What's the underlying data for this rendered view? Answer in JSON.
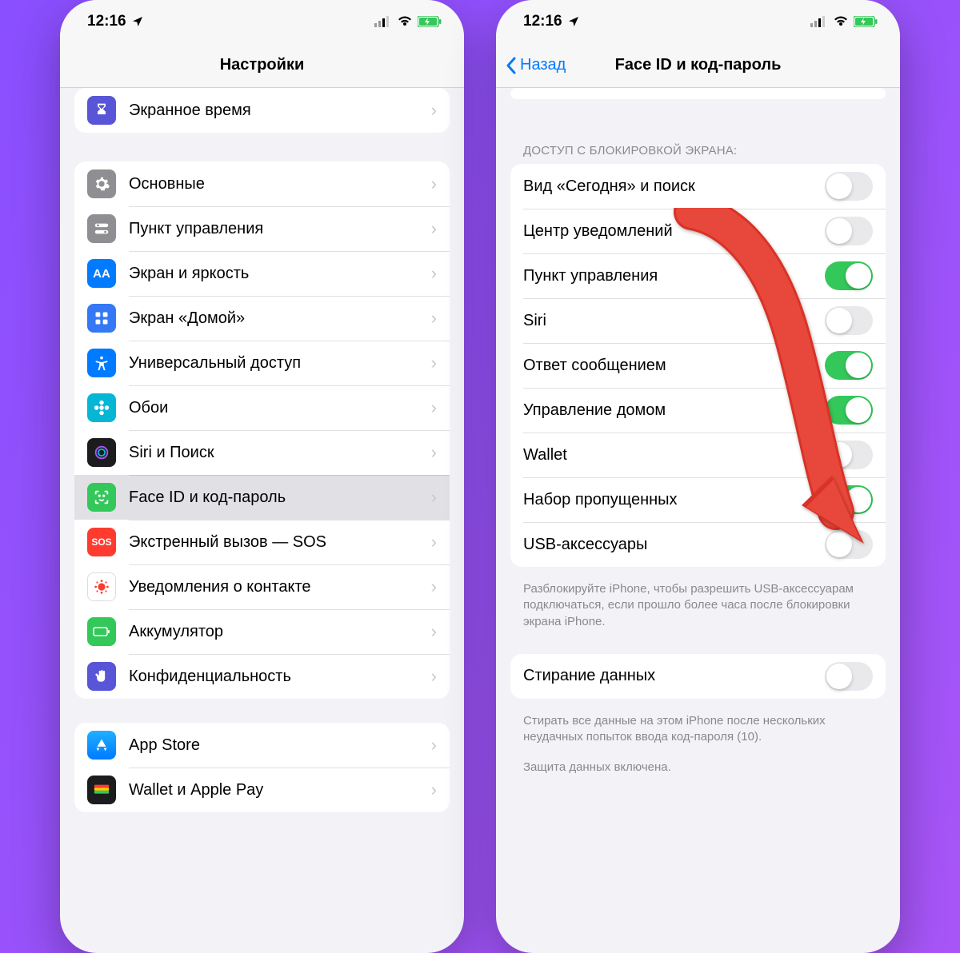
{
  "status": {
    "time": "12:16"
  },
  "left": {
    "nav_title": "Настройки",
    "g1": [
      {
        "id": "screen-time",
        "label": "Экранное время"
      }
    ],
    "g2": [
      {
        "id": "general",
        "label": "Основные"
      },
      {
        "id": "control-center",
        "label": "Пункт управления"
      },
      {
        "id": "display",
        "label": "Экран и яркость"
      },
      {
        "id": "home-screen",
        "label": "Экран «Домой»"
      },
      {
        "id": "accessibility",
        "label": "Универсальный доступ"
      },
      {
        "id": "wallpaper",
        "label": "Обои"
      },
      {
        "id": "siri",
        "label": "Siri и Поиск"
      },
      {
        "id": "faceid",
        "label": "Face ID и код-пароль"
      },
      {
        "id": "sos",
        "label": "Экстренный вызов — SOS"
      },
      {
        "id": "exposure",
        "label": "Уведомления о контакте"
      },
      {
        "id": "battery",
        "label": "Аккумулятор"
      },
      {
        "id": "privacy",
        "label": "Конфиденциальность"
      }
    ],
    "g3": [
      {
        "id": "appstore",
        "label": "App Store"
      },
      {
        "id": "wallet",
        "label": "Wallet и Apple Pay"
      }
    ]
  },
  "right": {
    "back_label": "Назад",
    "nav_title": "Face ID и код-пароль",
    "section_header": "ДОСТУП С БЛОКИРОВКОЙ ЭКРАНА:",
    "toggles": [
      {
        "id": "today",
        "label": "Вид «Сегодня» и поиск",
        "on": false
      },
      {
        "id": "notif-center",
        "label": "Центр уведомлений",
        "on": false
      },
      {
        "id": "control-center",
        "label": "Пункт управления",
        "on": true
      },
      {
        "id": "siri",
        "label": "Siri",
        "on": false
      },
      {
        "id": "reply",
        "label": "Ответ сообщением",
        "on": true
      },
      {
        "id": "home-control",
        "label": "Управление домом",
        "on": true
      },
      {
        "id": "wallet",
        "label": "Wallet",
        "on": false
      },
      {
        "id": "missed",
        "label": "Набор пропущенных",
        "on": true
      },
      {
        "id": "usb",
        "label": "USB-аксессуары",
        "on": false
      }
    ],
    "footer1": "Разблокируйте iPhone, чтобы разрешить USB-аксессуарам подключаться, если прошло более часа после блокировки экрана iPhone.",
    "erase_label": "Стирание данных",
    "erase_on": false,
    "footer2": "Стирать все данные на этом iPhone после нескольких неудачных попыток ввода код-пароля (10).",
    "footer3": "Защита данных включена."
  }
}
